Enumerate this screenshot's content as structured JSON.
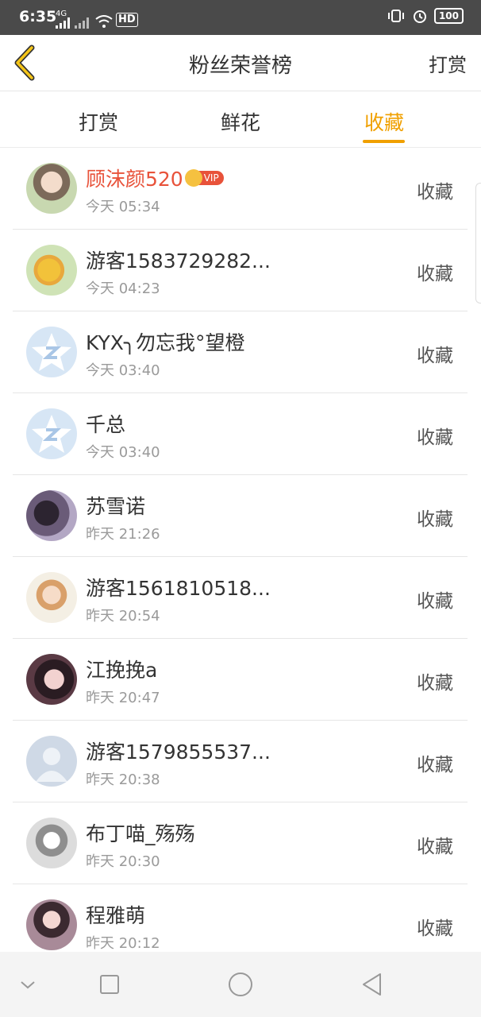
{
  "status": {
    "time": "6:35",
    "net1": "4G",
    "battery": "100"
  },
  "header": {
    "title": "粉丝荣誉榜",
    "action": "打赏"
  },
  "tabs": [
    {
      "label": "打赏",
      "active": false
    },
    {
      "label": "鲜花",
      "active": false
    },
    {
      "label": "收藏",
      "active": true
    }
  ],
  "accent": "#f0a000",
  "vip_badge_label": "VIP",
  "rows": [
    {
      "name": "顾沫颜520",
      "time": "今天 05:34",
      "action": "收藏",
      "vip": true,
      "avatar": "photo"
    },
    {
      "name": "游客1583729282...",
      "time": "今天 04:23",
      "action": "收藏",
      "avatar": "photo"
    },
    {
      "name": "KYX╮勿忘我°望橙",
      "time": "今天 03:40",
      "action": "收藏",
      "avatar": "default-qq"
    },
    {
      "name": "千总",
      "time": "今天 03:40",
      "action": "收藏",
      "avatar": "default-qq"
    },
    {
      "name": "苏雪诺",
      "time": "昨天 21:26",
      "action": "收藏",
      "avatar": "photo"
    },
    {
      "name": "游客1561810518...",
      "time": "昨天 20:54",
      "action": "收藏",
      "avatar": "photo"
    },
    {
      "name": "江挽挽a",
      "time": "昨天 20:47",
      "action": "收藏",
      "avatar": "photo"
    },
    {
      "name": "游客1579855537...",
      "time": "昨天 20:38",
      "action": "收藏",
      "avatar": "default-person"
    },
    {
      "name": "布丁喵_殇殇",
      "time": "昨天 20:30",
      "action": "收藏",
      "avatar": "photo"
    },
    {
      "name": "程雅萌",
      "time": "昨天 20:12",
      "action": "收藏",
      "avatar": "photo"
    }
  ]
}
